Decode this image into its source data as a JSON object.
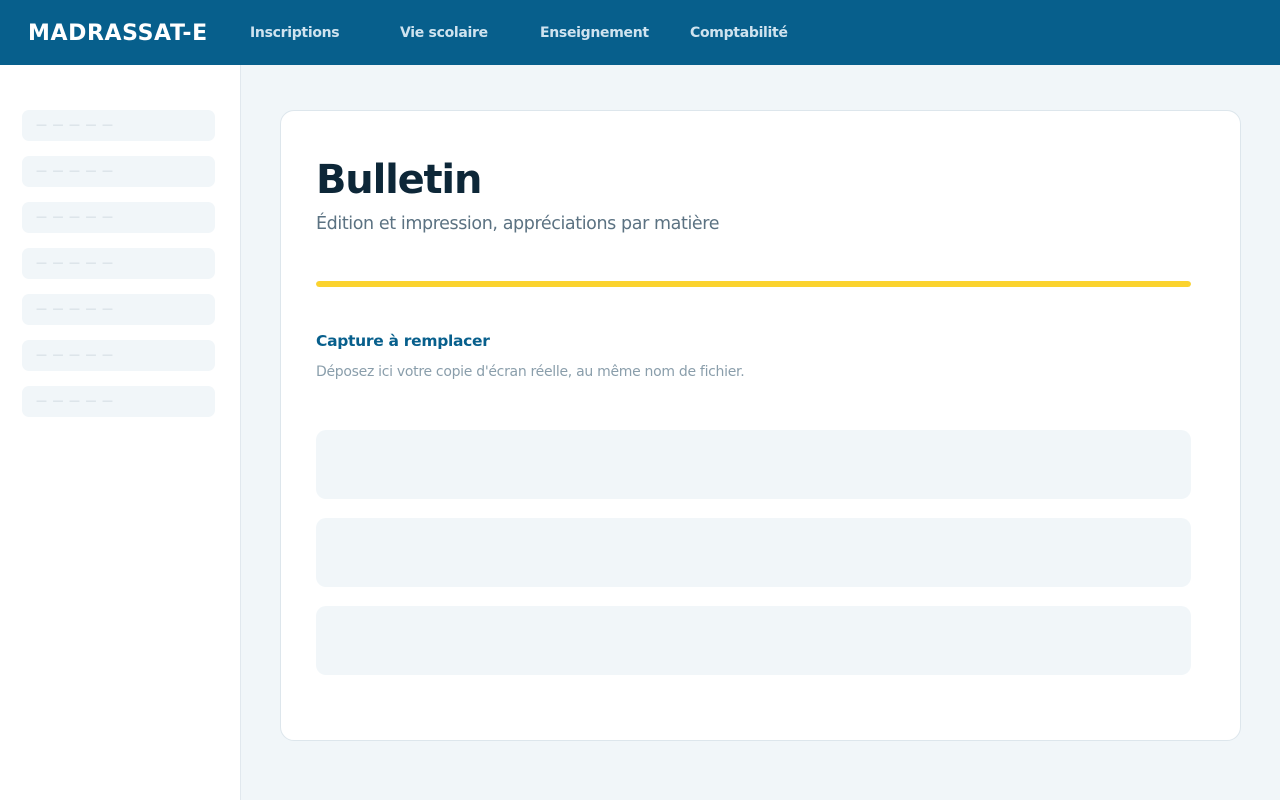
{
  "header": {
    "brand": "MADRASSAT-E",
    "nav": [
      "Inscriptions",
      "Vie scolaire",
      "Enseignement",
      "Comptabilité"
    ]
  },
  "sidebar": {
    "items": [
      {
        "label": "— — — — —"
      },
      {
        "label": "— — — — —"
      },
      {
        "label": "— — — — —"
      },
      {
        "label": "— — — — —"
      },
      {
        "label": "— — — — —"
      },
      {
        "label": "— — — — —"
      },
      {
        "label": "— — — — —"
      }
    ]
  },
  "main": {
    "title": "Bulletin",
    "subtitle": "Édition et impression, appréciations par matière",
    "progress": 1.0,
    "section_title": "Capture à remplacer",
    "section_desc": "Déposez ici votre copie d'écran réelle, au même nom de fichier."
  },
  "colors": {
    "topbar": "#075f8c",
    "accent": "#fbd32e",
    "title": "#0d2738"
  }
}
